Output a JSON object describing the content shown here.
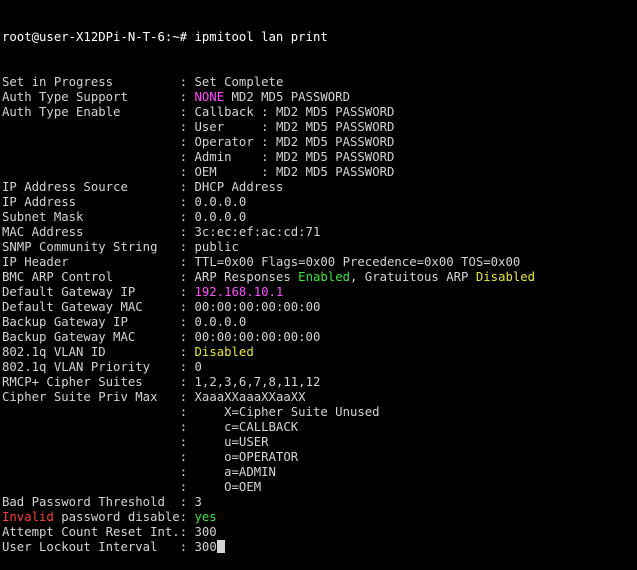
{
  "colors": {
    "background": "#000000",
    "default_text": "#d3d3d3",
    "magenta": "#ff4cff",
    "green": "#3ce63c",
    "yellow": "#e6e63c",
    "red": "#ff3c3c"
  },
  "prompt": {
    "text": "root@user-X12DPi-N-T-6:~# ",
    "command": "ipmitool lan print"
  },
  "rows": [
    {
      "label": "Set in Progress",
      "sep": ": ",
      "value": "Set Complete"
    },
    {
      "label": "Auth Type Support",
      "sep": ": ",
      "value_highlight": "NONE",
      "value_rest": " MD2 MD5 PASSWORD"
    },
    {
      "label": "Auth Type Enable",
      "sep": ": ",
      "role": "Callback",
      "role_sep": " : ",
      "value": "MD2 MD5 PASSWORD"
    },
    {
      "label": "",
      "sep": ": ",
      "role": "User",
      "role_sep": " : ",
      "value": "MD2 MD5 PASSWORD"
    },
    {
      "label": "",
      "sep": ": ",
      "role": "Operator",
      "role_sep": " : ",
      "value": "MD2 MD5 PASSWORD"
    },
    {
      "label": "",
      "sep": ": ",
      "role": "Admin",
      "role_sep": " : ",
      "value": "MD2 MD5 PASSWORD"
    },
    {
      "label": "",
      "sep": ": ",
      "role": "OEM",
      "role_sep": " : ",
      "value": "MD2 MD5 PASSWORD"
    },
    {
      "label": "IP Address Source",
      "sep": ": ",
      "value": "DHCP Address"
    },
    {
      "label": "IP Address",
      "sep": ": ",
      "value": "0.0.0.0"
    },
    {
      "label": "Subnet Mask",
      "sep": ": ",
      "value": "0.0.0.0"
    },
    {
      "label": "MAC Address",
      "sep": ": ",
      "value": "3c:ec:ef:ac:cd:71"
    },
    {
      "label": "SNMP Community String",
      "sep": ": ",
      "value": "public"
    },
    {
      "label": "IP Header",
      "sep": ": ",
      "value": "TTL=0x00 Flags=0x00 Precedence=0x00 TOS=0x00"
    },
    {
      "label": "BMC ARP Control",
      "sep": ": ",
      "arp_a": "ARP Responses ",
      "arp_enabled": "Enabled",
      "arp_b": ", Gratuitous ARP ",
      "arp_disabled": "Disabled"
    },
    {
      "label": "Default Gateway IP",
      "sep": ": ",
      "value_ip": "192.168.10.1"
    },
    {
      "label": "Default Gateway MAC",
      "sep": ": ",
      "value": "00:00:00:00:00:00"
    },
    {
      "label": "Backup Gateway IP",
      "sep": ": ",
      "value": "0.0.0.0"
    },
    {
      "label": "Backup Gateway MAC",
      "sep": ": ",
      "value": "00:00:00:00:00:00"
    },
    {
      "label": "802.1q VLAN ID",
      "sep": ": ",
      "value_yellow": "Disabled"
    },
    {
      "label": "802.1q VLAN Priority",
      "sep": ": ",
      "value": "0"
    },
    {
      "label": "RMCP+ Cipher Suites",
      "sep": ": ",
      "value": "1,2,3,6,7,8,11,12"
    },
    {
      "label": "Cipher Suite Priv Max",
      "sep": ": ",
      "value": "XaaaXXaaaXXaaXX"
    },
    {
      "label": "",
      "sep": ": ",
      "value": "    X=Cipher Suite Unused"
    },
    {
      "label": "",
      "sep": ": ",
      "value": "    c=CALLBACK"
    },
    {
      "label": "",
      "sep": ": ",
      "value": "    u=USER"
    },
    {
      "label": "",
      "sep": ": ",
      "value": "    o=OPERATOR"
    },
    {
      "label": "",
      "sep": ": ",
      "value": "    a=ADMIN"
    },
    {
      "label": "",
      "sep": ": ",
      "value": "    O=OEM"
    },
    {
      "label": "Bad Password Threshold",
      "sep": ": ",
      "value": "3"
    },
    {
      "label_red": "Invalid",
      "label_rest": " password disable",
      "sep": ": ",
      "value_green": "yes"
    },
    {
      "label": "Attempt Count Reset Int.",
      "sep": ": ",
      "value": "300"
    },
    {
      "label": "User Lockout Interval",
      "sep": ": ",
      "value": "300"
    }
  ]
}
